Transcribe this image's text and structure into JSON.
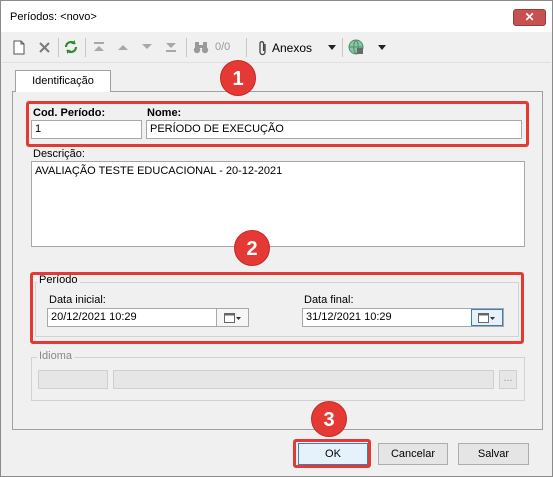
{
  "window": {
    "title": "Períodos: <novo>",
    "close_symbol": "✕"
  },
  "toolbar": {
    "record_counter": "0/0",
    "anexos_label": "Anexos",
    "icons": [
      "new-document-icon",
      "delete-icon",
      "refresh-icon",
      "first-record-icon",
      "previous-record-icon",
      "next-record-icon",
      "last-record-icon",
      "binoculars-icon",
      "paperclip-icon",
      "dropdown-arrow-icon",
      "globe-icon",
      "dropdown-arrow-icon"
    ]
  },
  "tab": {
    "label": "Identificação"
  },
  "form": {
    "cod_label": "Cod. Período:",
    "cod_value": "1",
    "nome_label": "Nome:",
    "nome_value": "PERÍODO DE EXECUÇÃO",
    "descricao_label": "Descrição:",
    "descricao_value": "AVALIAÇÃO TESTE EDUCACIONAL - 20-12-2021",
    "periodo_legend": "Período",
    "data_inicial_label": "Data inicial:",
    "data_inicial_value": "20/12/2021 10:29",
    "data_final_label": "Data final:",
    "data_final_value": "31/12/2021 10:29",
    "idioma_legend": "Idioma",
    "idioma_button": "..."
  },
  "buttons": {
    "ok": "OK",
    "cancelar": "Cancelar",
    "salvar": "Salvar"
  },
  "annotations": {
    "badge1": "1",
    "badge2": "2",
    "badge3": "3"
  },
  "colors": {
    "highlight": "#e53935",
    "focus": "#3c7fb1"
  }
}
